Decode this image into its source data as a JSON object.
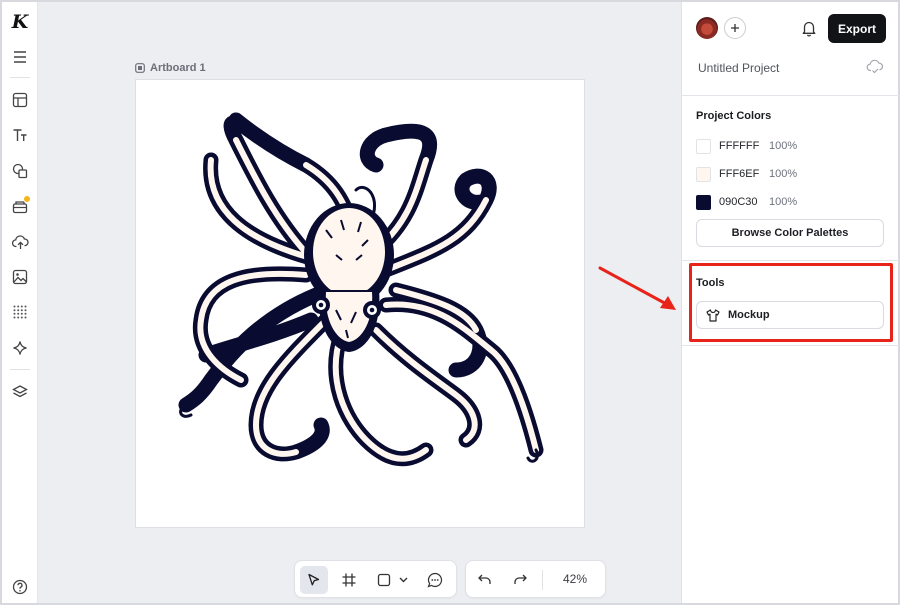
{
  "app": {
    "logo_letter": "K"
  },
  "rail": {
    "items": [
      {
        "name": "menu-icon"
      },
      {
        "name": "templates-icon"
      },
      {
        "name": "text-icon"
      },
      {
        "name": "shapes-icon"
      },
      {
        "name": "elements-icon"
      },
      {
        "name": "upload-icon"
      },
      {
        "name": "image-icon"
      },
      {
        "name": "pattern-icon"
      },
      {
        "name": "ai-sparkle-icon"
      },
      {
        "name": "layers-icon"
      },
      {
        "name": "help-icon"
      }
    ]
  },
  "canvas": {
    "artboard_label": "Artboard 1",
    "content_icon": "octopus-illustration"
  },
  "toolbar": {
    "tools": [
      "select-tool",
      "frame-tool",
      "shape-tool",
      "comment-tool"
    ],
    "zoom": "42%"
  },
  "header": {
    "export_label": "Export",
    "project_name": "Untitled Project"
  },
  "project_colors": {
    "title": "Project Colors",
    "colors": [
      {
        "hex": "FFFFFF",
        "opacity": "100%",
        "color": "#FFFFFF"
      },
      {
        "hex": "FFF6EF",
        "opacity": "100%",
        "color": "#FFF6EF"
      },
      {
        "hex": "090C30",
        "opacity": "100%",
        "color": "#090C30"
      }
    ],
    "browse_label": "Browse Color Palettes"
  },
  "tools_section": {
    "title": "Tools",
    "mockup_label": "Mockup"
  },
  "annotation": {
    "highlight_color": "#E8231A"
  }
}
